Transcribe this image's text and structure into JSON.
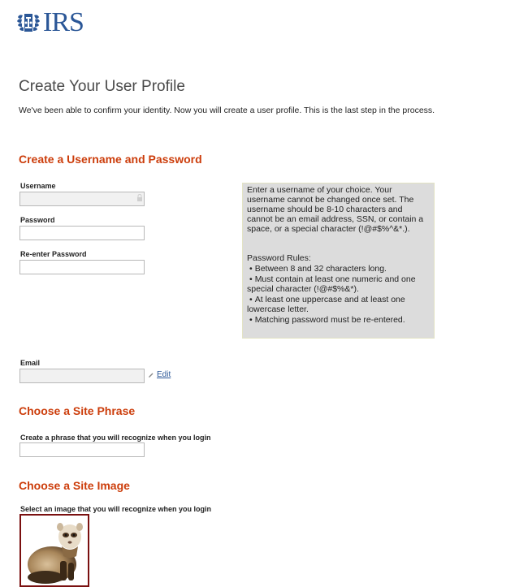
{
  "header": {
    "logo_text": "IRS",
    "logo_icon": "irs-eagle-icon",
    "brand_color": "#2b5797"
  },
  "page": {
    "title": "Create Your User Profile",
    "intro": "We've been able to confirm your identity. Now you will create a user profile. This is the last step in the process."
  },
  "credentials": {
    "section_title": "Create a Username and Password",
    "username_label": "Username",
    "username_value": "",
    "password_label": "Password",
    "password_value": "",
    "reenter_label": "Re-enter Password",
    "reenter_value": ""
  },
  "help": {
    "username_text": "Enter a username of your choice. Your username cannot be changed once set. The username should be 8-10 characters and cannot be an email address, SSN, or contain a space, or a special character (!@#$%^&*.).",
    "rules_title": "Password Rules:",
    "rules": [
      "Between 8 and 32 characters long.",
      "Must contain at least one numeric and one special character (!@#$%&*).",
      "At least one uppercase and at least one lowercase letter.",
      "Matching password must be re-entered."
    ]
  },
  "email": {
    "label": "Email",
    "value": "",
    "edit_label": "Edit"
  },
  "site_phrase": {
    "section_title": "Choose a Site Phrase",
    "label": "Create a phrase that you will recognize when you login",
    "value": ""
  },
  "site_image": {
    "section_title": "Choose a Site Image",
    "label": "Select an image that you will recognize when you login",
    "selected_image": "ferret"
  },
  "colors": {
    "section_heading": "#cc3d0b",
    "help_box_bg": "#dcdcdc",
    "selected_border": "#7a1010"
  }
}
